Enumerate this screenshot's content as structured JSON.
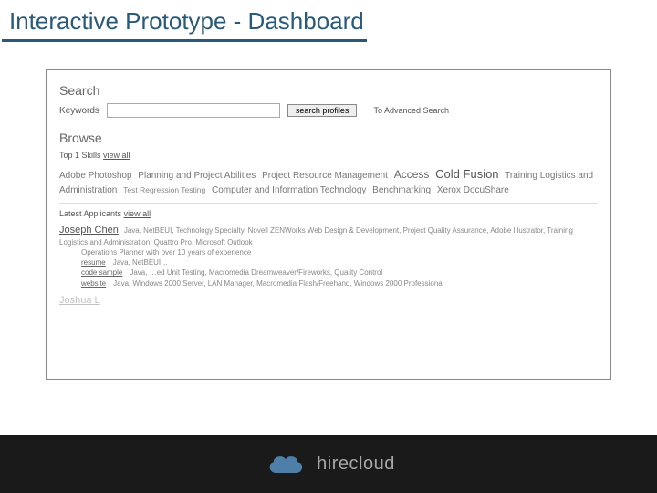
{
  "slide": {
    "title": "Interactive Prototype - Dashboard"
  },
  "search": {
    "heading": "Search",
    "keywords_label": "Keywords",
    "input_value": "",
    "placeholder": "",
    "button_label": "search profiles",
    "advanced_link": "To Advanced Search"
  },
  "browse": {
    "heading": "Browse",
    "top_skills_label": "Top 1  Skills",
    "view_all": "view all",
    "tags": [
      {
        "text": "Adobe Photoshop",
        "size": "md"
      },
      {
        "text": "Planning and Project Abilities",
        "size": "md"
      },
      {
        "text": "Project Resource Management",
        "size": "md"
      },
      {
        "text": "Access",
        "size": "lg"
      },
      {
        "text": "Cold Fusion",
        "size": "xl"
      },
      {
        "text": "Training Logistics and Administration",
        "size": "md"
      },
      {
        "text": "Test Regression Testing",
        "size": "sm"
      },
      {
        "text": "Computer and Information Technology",
        "size": "md"
      },
      {
        "text": "Benchmarking",
        "size": "md"
      },
      {
        "text": "Xerox DocuShare",
        "size": "md"
      }
    ],
    "latest_applicants_label": "Latest Applicants",
    "view_all2": "view all"
  },
  "applicants": [
    {
      "name": "Joseph Chen",
      "skills": "Java, NetBEUI, Technology Specialty, Novell ZENWorks Web Design & Development, Project Quality Assurance, Adobe Illustrator, Training Logistics and Administration, Quattro Pro, Microsoft Outlook",
      "tagline": "Operations Planner with over 10 years of experience",
      "links": [
        {
          "label": "resume",
          "meta": "Java, NetBEUI…"
        },
        {
          "label": "code sample",
          "meta": "Java, …ed Unit Testing, Macromedia Dreamweaver/Fireworks, Quality Control"
        },
        {
          "label": "website",
          "meta": "Java, Windows 2000 Server, LAN Manager, Macromedia Flash/Freehand, Windows 2000 Professional"
        }
      ]
    },
    {
      "name": "Joshua L",
      "skills": ""
    }
  ],
  "footer": {
    "brand": "hirecloud",
    "icon": "cloud-icon"
  }
}
